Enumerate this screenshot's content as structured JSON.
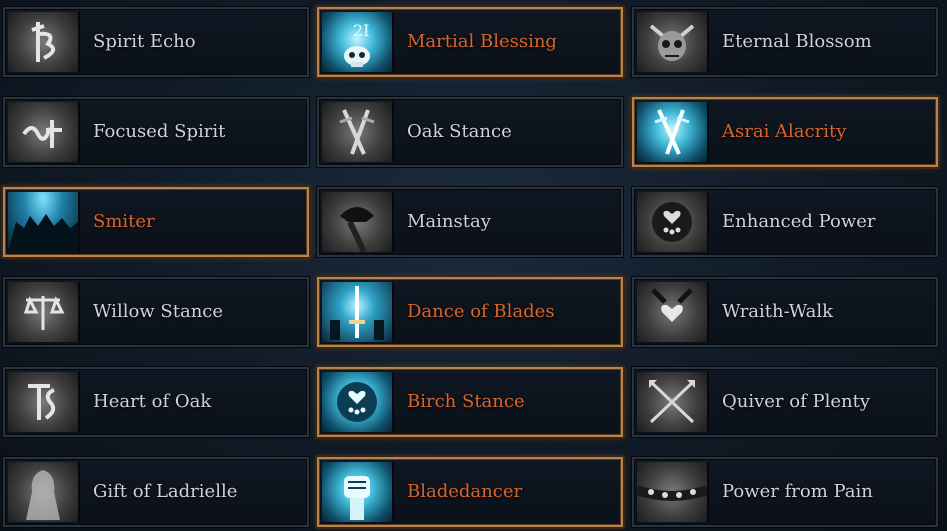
{
  "talents": [
    {
      "label": "Spirit Echo",
      "icon": "rune-b-icon",
      "selected": false
    },
    {
      "label": "Martial Blessing",
      "icon": "skull-rune-icon",
      "selected": true
    },
    {
      "label": "Eternal Blossom",
      "icon": "horned-skull-icon",
      "selected": false
    },
    {
      "label": "Focused Spirit",
      "icon": "rune-glyph-icon",
      "selected": false
    },
    {
      "label": "Oak Stance",
      "icon": "crossed-blades-icon",
      "selected": false
    },
    {
      "label": "Asrai Alacrity",
      "icon": "crossed-blades-icon",
      "selected": true
    },
    {
      "label": "Smiter",
      "icon": "silhouettes-icon",
      "selected": true
    },
    {
      "label": "Mainstay",
      "icon": "dark-rider-icon",
      "selected": false
    },
    {
      "label": "Enhanced Power",
      "icon": "heart-drops-icon",
      "selected": false
    },
    {
      "label": "Willow Stance",
      "icon": "rune-scale-icon",
      "selected": false
    },
    {
      "label": "Dance of Blades",
      "icon": "glowing-sword-icon",
      "selected": true
    },
    {
      "label": "Wraith-Walk",
      "icon": "wraith-heart-icon",
      "selected": false
    },
    {
      "label": "Heart of Oak",
      "icon": "rune-ts-icon",
      "selected": false
    },
    {
      "label": "Birch Stance",
      "icon": "heart-drops-icon",
      "selected": true
    },
    {
      "label": "Quiver of Plenty",
      "icon": "crossed-arrows-icon",
      "selected": false
    },
    {
      "label": "Gift of Ladrielle",
      "icon": "hooded-figure-icon",
      "selected": false
    },
    {
      "label": "Bladedancer",
      "icon": "raised-fist-icon",
      "selected": true
    },
    {
      "label": "Power from Pain",
      "icon": "spiked-band-icon",
      "selected": false
    }
  ],
  "colors": {
    "selected_label": "#d8662b",
    "normal_label": "#cfd3d8",
    "selected_border": "#b5844f"
  }
}
